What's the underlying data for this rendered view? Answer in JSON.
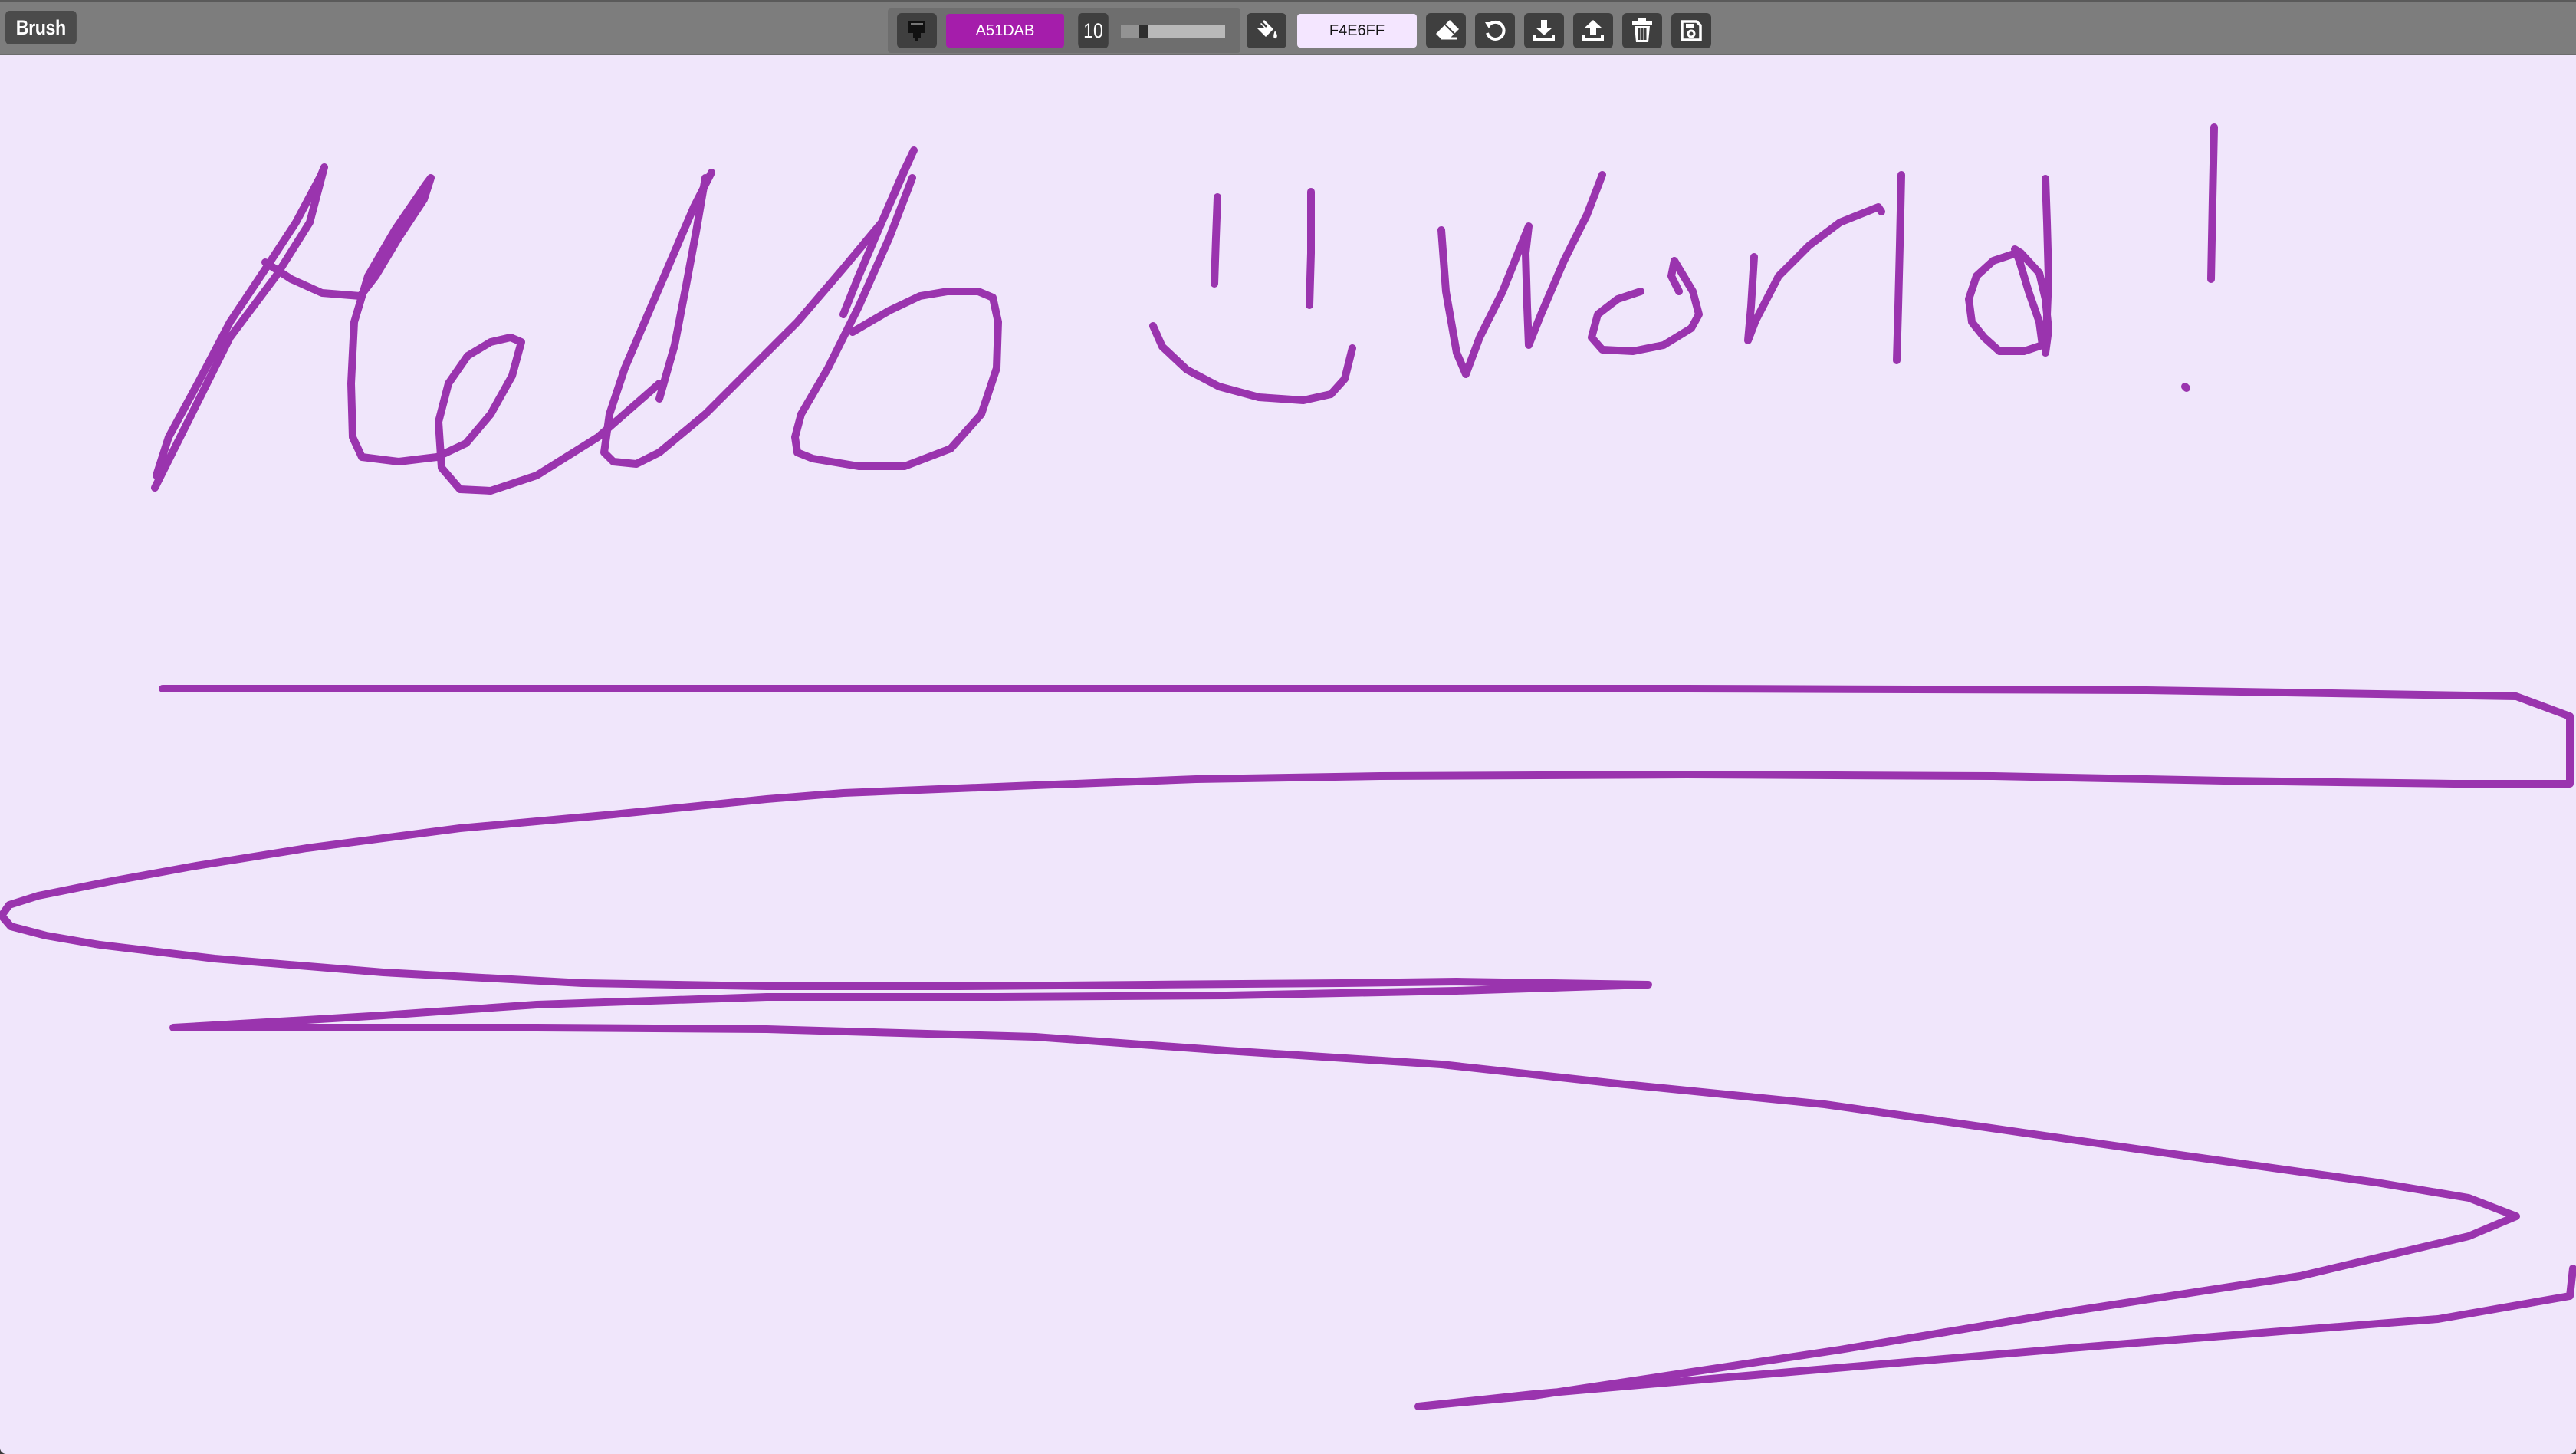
{
  "toolbar": {
    "mode_label": "Brush",
    "brush_color": "A51DAB",
    "brush_size": "10",
    "brush_size_value": 10,
    "background_color": "F4E6FF",
    "icons": {
      "brush": "brush-icon",
      "bucket": "paint-bucket-icon",
      "eraser": "eraser-icon",
      "undo": "undo-icon",
      "download": "download-icon",
      "upload": "upload-icon",
      "trash": "trash-icon",
      "save": "save-icon"
    }
  },
  "colors": {
    "brush": "#a51dab",
    "stroke_render": "#9a34ae",
    "canvas_background": "#f0e6fb",
    "toolbar": "#7d7d7d",
    "button": "#3f3f3f"
  }
}
